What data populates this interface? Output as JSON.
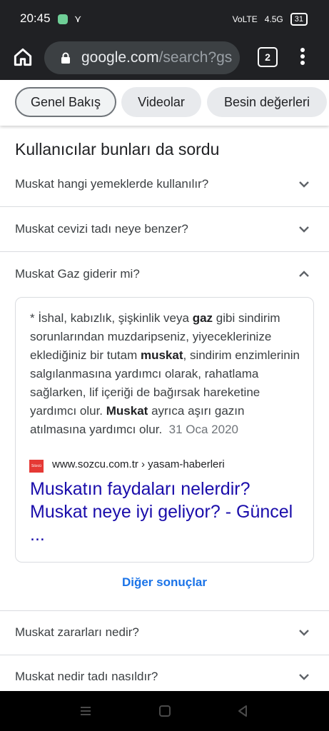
{
  "status": {
    "time": "20:45",
    "small_icon": "⋎",
    "network": "VoLTE",
    "signal": "4.5G",
    "battery": "31"
  },
  "browser": {
    "url_host": "google.com",
    "url_path": "/search?gs",
    "tab_count": "2"
  },
  "chips": [
    "Genel Bakış",
    "Videolar",
    "Besin değerleri"
  ],
  "section_title": "Kullanıcılar bunları da sordu",
  "questions": {
    "q1": "Muskat hangi yemeklerde kullanılır?",
    "q2": "Muskat cevizi tadı neye benzer?",
    "q3": "Muskat Gaz giderir mi?",
    "q4": "Muskat zararları nedir?",
    "q5": "Muskat nedir tadı nasıldır?"
  },
  "answer": {
    "part1": "* İshal, kabızlık, şişkinlik veya ",
    "bold1": "gaz",
    "part2": " gibi sindirim sorunlarından muzdaripseniz, yiyeceklerinize eklediğiniz bir tutam ",
    "bold2": "muskat",
    "part3": ", sindirim enzimlerinin salgılanmasına yardımcı olarak, rahatlama sağlarken, lif içeriği de bağırsak hareketine yardımcı olur. ",
    "bold3": "Muskat",
    "part4": " ayrıca aşırı gazın atılmasına yardımcı olur.",
    "date": "31 Oca 2020",
    "favicon_text": "Sözcü",
    "source": "www.sozcu.com.tr › yasam-haberleri",
    "link_title": "Muskatın faydaları nelerdir? Muskat neye iyi geliyor? - Güncel ..."
  },
  "more_results": "Diğer sonuçlar",
  "colors": {
    "link": "#1a0dab",
    "accent": "#1a73e8",
    "toolbar": "#202124"
  },
  "icons": [
    "home-icon",
    "lock-icon",
    "more-vert-icon",
    "chevron-down-icon",
    "chevron-up-icon",
    "menu-nav-icon",
    "square-nav-icon",
    "back-nav-icon"
  ]
}
